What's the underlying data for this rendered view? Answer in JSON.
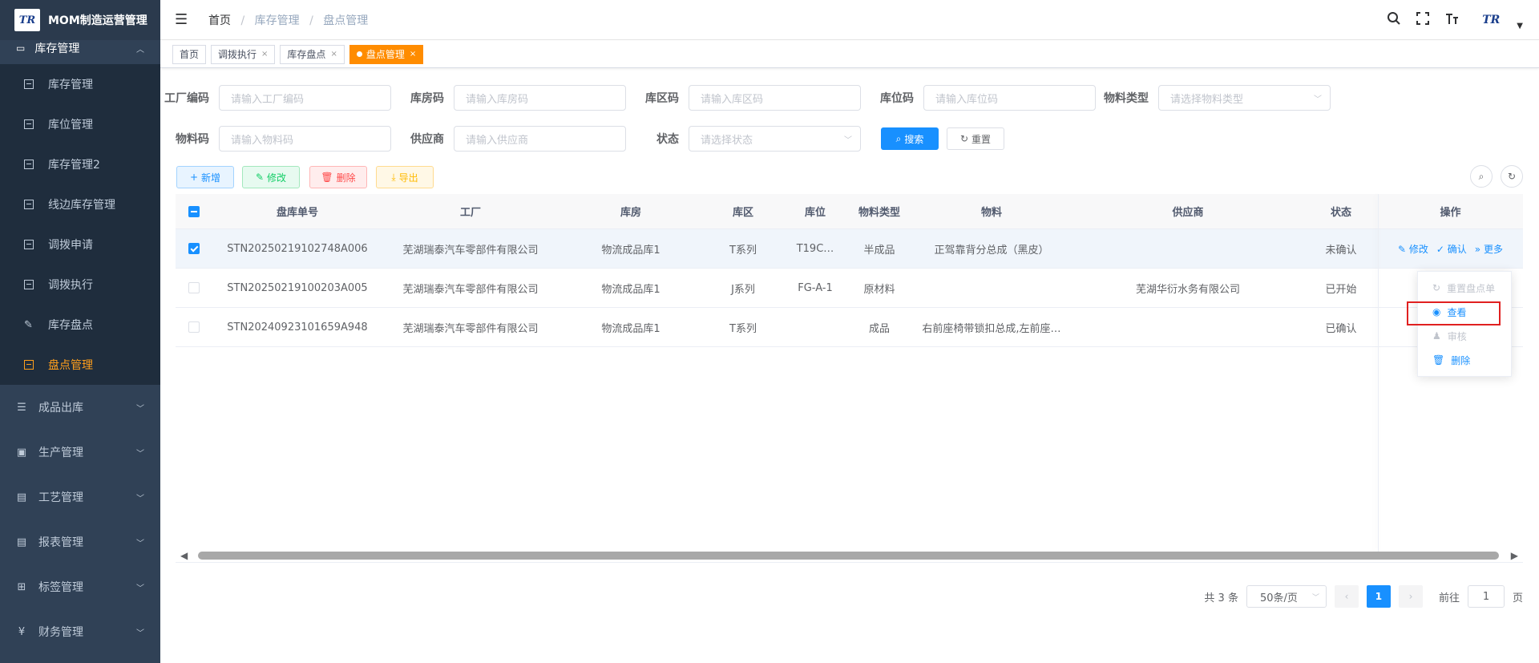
{
  "app": {
    "logo_text": "TR",
    "title": "MOM制造运营管理"
  },
  "sidebar": {
    "top_label": "库存管理",
    "sub_items": [
      {
        "label": "库存管理"
      },
      {
        "label": "库位管理"
      },
      {
        "label": "库存管理2"
      },
      {
        "label": "线边库存管理"
      },
      {
        "label": "调拨申请"
      },
      {
        "label": "调拨执行"
      },
      {
        "label": "库存盘点"
      },
      {
        "label": "盘点管理"
      }
    ],
    "groups": [
      {
        "label": "成品出库",
        "icon": "list-icon"
      },
      {
        "label": "生产管理",
        "icon": "monitor-icon"
      },
      {
        "label": "工艺管理",
        "icon": "print-icon"
      },
      {
        "label": "报表管理",
        "icon": "print-icon"
      },
      {
        "label": "标签管理",
        "icon": "grid-icon"
      },
      {
        "label": "财务管理",
        "icon": "yen-icon",
        "glyph": "¥"
      }
    ]
  },
  "header": {
    "breadcrumb": [
      "首页",
      "库存管理",
      "盘点管理"
    ],
    "avatar_text": "TR"
  },
  "tags": [
    {
      "label": "首页"
    },
    {
      "label": "调拨执行"
    },
    {
      "label": "库存盘点"
    },
    {
      "label": "盘点管理"
    }
  ],
  "filters": {
    "factory": {
      "label": "工厂编码",
      "placeholder": "请输入工厂编码"
    },
    "warehouse": {
      "label": "库房码",
      "placeholder": "请输入库房码"
    },
    "area": {
      "label": "库区码",
      "placeholder": "请输入库区码"
    },
    "location": {
      "label": "库位码",
      "placeholder": "请输入库位码"
    },
    "material_type": {
      "label": "物料类型",
      "placeholder": "请选择物料类型"
    },
    "material": {
      "label": "物料码",
      "placeholder": "请输入物料码"
    },
    "supplier": {
      "label": "供应商",
      "placeholder": "请输入供应商"
    },
    "status": {
      "label": "状态",
      "placeholder": "请选择状态"
    },
    "search_label": "搜索",
    "reset_label": "重置"
  },
  "toolbar": {
    "add": "新增",
    "edit": "修改",
    "delete": "删除",
    "export": "导出"
  },
  "table": {
    "columns": [
      "盘库单号",
      "工厂",
      "库房",
      "库区",
      "库位",
      "物料类型",
      "物料",
      "供应商",
      "状态",
      "操作"
    ],
    "rows": [
      {
        "no": "STN20250219102748A006",
        "factory": "芜湖瑞泰汽车零部件有限公司",
        "warehouse": "物流成品库1",
        "area": "T系列",
        "location": "T19C…",
        "mtype": "半成品",
        "material": "正驾靠背分总成（黑皮）",
        "supplier": "",
        "status": "未确认",
        "checked": true
      },
      {
        "no": "STN20250219100203A005",
        "factory": "芜湖瑞泰汽车零部件有限公司",
        "warehouse": "物流成品库1",
        "area": "J系列",
        "location": "FG-A-1",
        "mtype": "原材料",
        "material": "",
        "supplier": "芜湖华衍水务有限公司",
        "status": "已开始",
        "checked": false
      },
      {
        "no": "STN20240923101659A948",
        "factory": "芜湖瑞泰汽车零部件有限公司",
        "warehouse": "物流成品库1",
        "area": "T系列",
        "location": "",
        "mtype": "成品",
        "material": "右前座椅带锁扣总成,左前座…",
        "supplier": "",
        "status": "已确认",
        "checked": false
      }
    ],
    "ops": {
      "edit": "修改",
      "confirm": "确认",
      "more": "更多"
    }
  },
  "more_menu": [
    {
      "label": "重置盘点单",
      "disabled": true
    },
    {
      "label": "查看",
      "disabled": false
    },
    {
      "label": "审核",
      "disabled": true
    },
    {
      "label": "删除",
      "disabled": false
    }
  ],
  "pagination": {
    "total": "共 3 条",
    "page_size": "50条/页",
    "current": "1",
    "goto_label": "前往",
    "goto_value": "1",
    "page_suffix": "页"
  }
}
